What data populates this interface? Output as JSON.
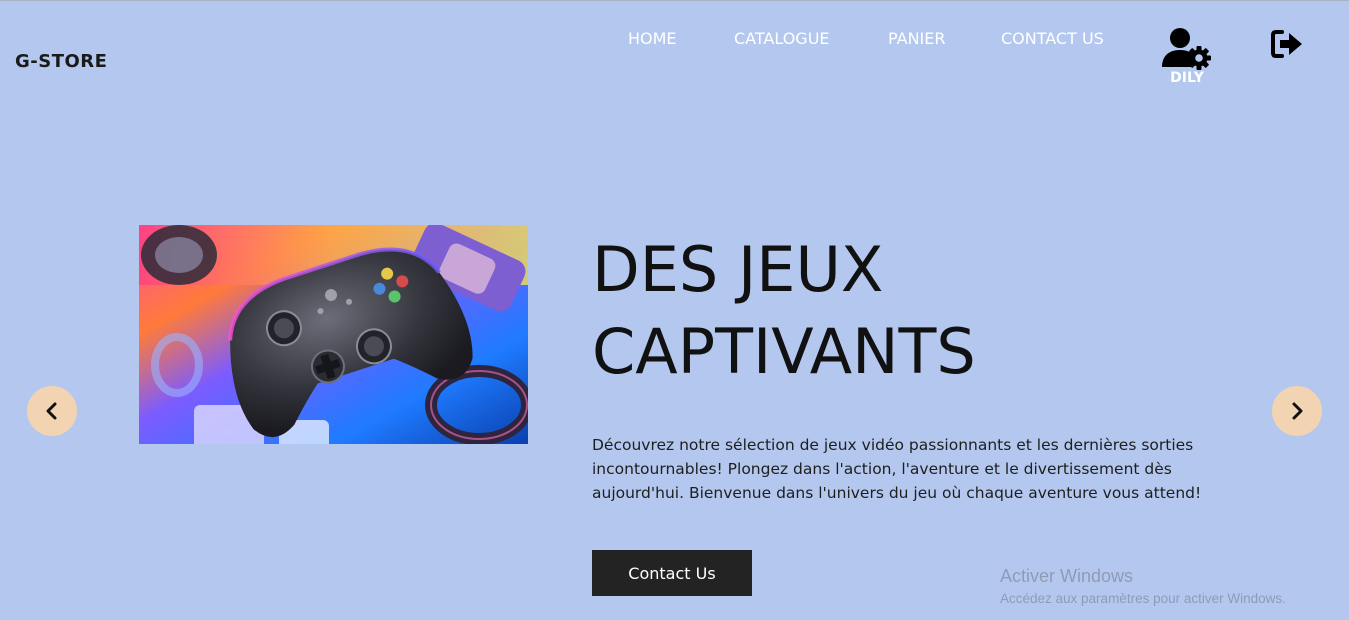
{
  "brand": "G-STORE",
  "nav": [
    "HOME",
    "CATALOGUE",
    "PANIER",
    "CONTACT US"
  ],
  "user": {
    "name": "DILY",
    "icon": "user-settings-icon"
  },
  "logout": {
    "icon": "logout-icon"
  },
  "carousel": {
    "prev_icon": "chevron-left-icon",
    "next_icon": "chevron-right-icon"
  },
  "hero": {
    "headline_line1": "DES JEUX",
    "headline_line2": "CAPTIVANTS",
    "description": "Découvrez notre sélection de jeux vidéo passionnants et les dernières sorties incontournables! Plongez dans l'action, l'aventure et le divertissement dès aujourd'hui. Bienvenue dans l'univers du jeu où chaque aventure vous attend!",
    "cta_label": "Contact Us"
  },
  "watermark": {
    "title": "Activer Windows",
    "subtitle": "Accédez aux paramètres pour activer Windows."
  },
  "colors": {
    "background": "#b4c8ef",
    "nav_text": "#ffffff",
    "arrow_bg": "#f2d4b2",
    "cta_bg": "#232323"
  }
}
